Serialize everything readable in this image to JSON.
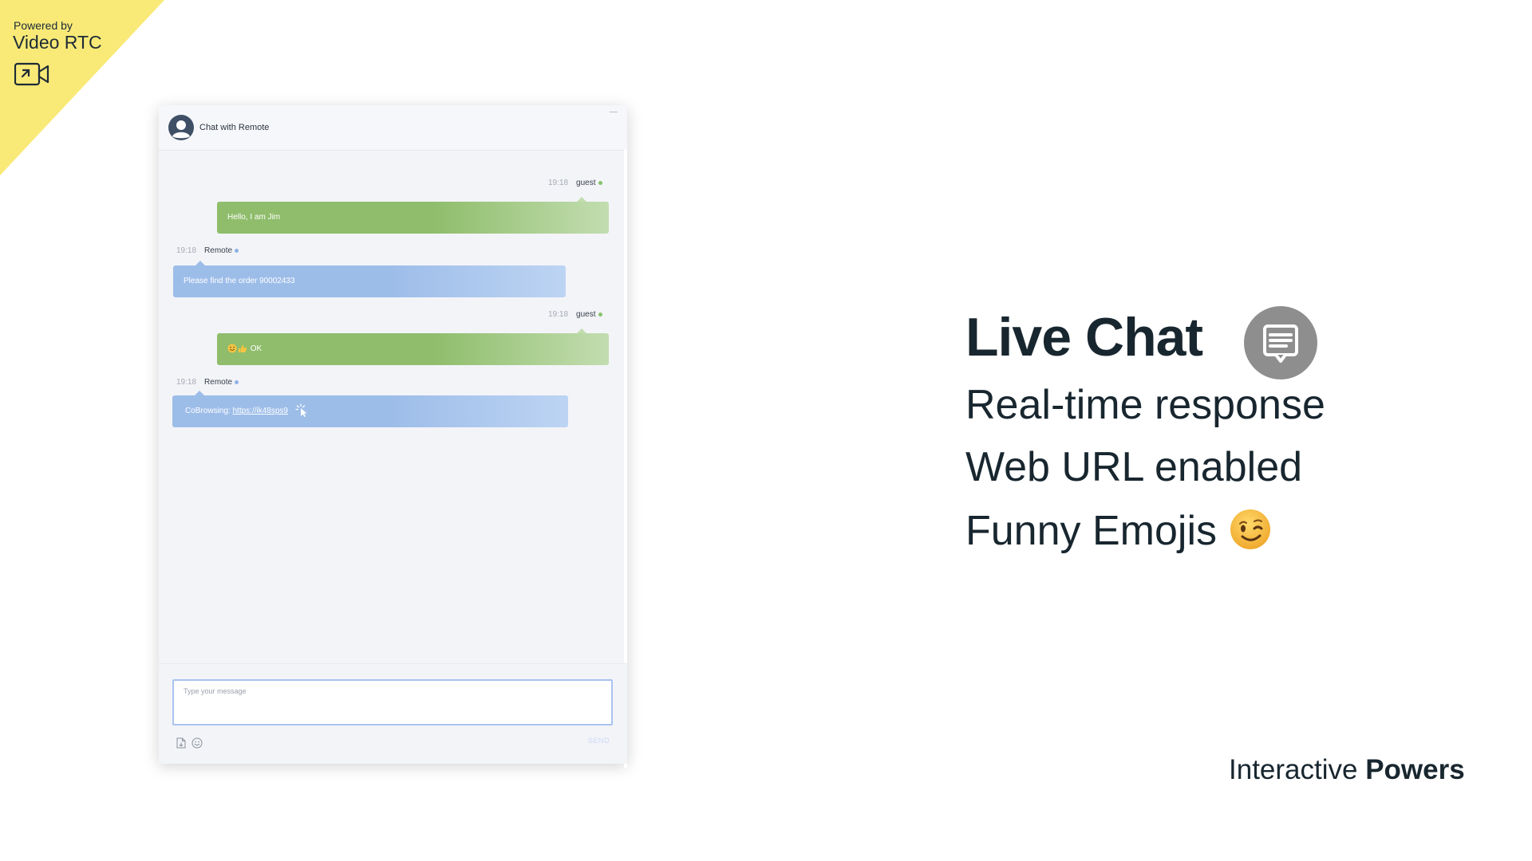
{
  "badge": {
    "powered_by": "Powered by",
    "brand": "Video RTC",
    "color": "#f9e977"
  },
  "chat": {
    "title": "Chat with Remote",
    "messages": [
      {
        "time": "19:18",
        "sender": "guest",
        "text": "Hello, I am Jim",
        "side": "right"
      },
      {
        "time": "19:18",
        "sender": "Remote",
        "text": "Please find the order 90002433",
        "side": "left"
      },
      {
        "time": "19:18",
        "sender": "guest",
        "emoji": [
          "smile-emoji",
          "thumbs-up-emoji"
        ],
        "text": "OK",
        "side": "right"
      },
      {
        "time": "19:18",
        "sender": "Remote",
        "prefix": "CoBrowsing:",
        "link": "https://ik48sps9",
        "icon": "cursor-click-icon",
        "side": "left"
      }
    ],
    "input_placeholder": "Type your message",
    "send_label": "SEND",
    "tools": [
      "attach-file-icon",
      "emoji-icon"
    ]
  },
  "promo": {
    "headline": "Live Chat",
    "features": [
      "Real-time response",
      "Web URL enabled",
      "Funny Emojis"
    ],
    "feature_emoji": "wink-emoji"
  },
  "footer": {
    "light": "Interactive",
    "bold": "Powers"
  },
  "colors": {
    "guest_bubble": "#8fbd6b",
    "remote_bubble": "#9dbde9",
    "text_dark": "#18262f",
    "chat_icon_bg": "#8e8e8e"
  }
}
